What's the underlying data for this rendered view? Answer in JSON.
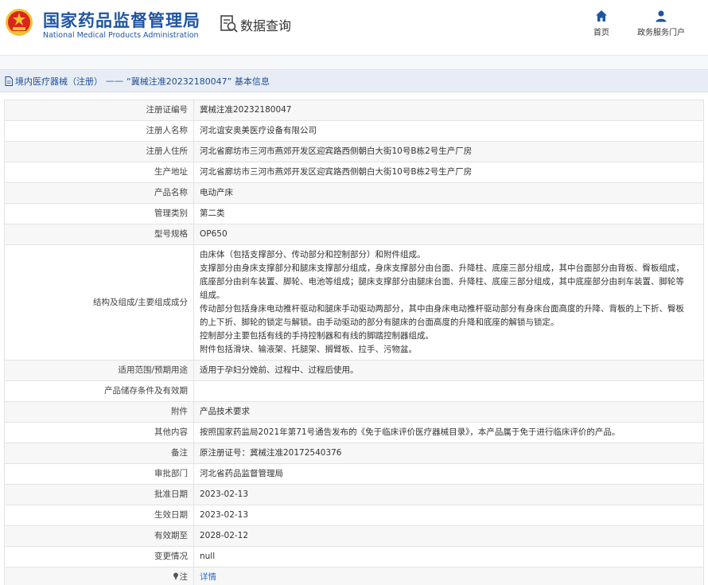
{
  "header": {
    "logo_cn": "国家药品监督管理局",
    "logo_en": "National Medical Products Administration",
    "query_title": "数据查询",
    "nav": [
      {
        "label": "首页",
        "icon": "home-icon"
      },
      {
        "label": "政务服务门户",
        "icon": "user-icon"
      }
    ]
  },
  "breadcrumb": {
    "category": "境内医疗器械（注册）",
    "separator": "——",
    "title": "“冀械注准20232180047” 基本信息"
  },
  "rows": [
    {
      "label": "注册证编号",
      "value": "冀械注准20232180047"
    },
    {
      "label": "注册人名称",
      "value": "河北谊安奥美医疗设备有限公司"
    },
    {
      "label": "注册人住所",
      "value": "河北省廊坊市三河市燕郊开发区迎宾路西侧朝白大街10号B栋2号生产厂房"
    },
    {
      "label": "生产地址",
      "value": "河北省廊坊市三河市燕郊开发区迎宾路西侧朝白大街10号B栋2号生产厂房"
    },
    {
      "label": "产品名称",
      "value": "电动产床"
    },
    {
      "label": "管理类别",
      "value": "第二类"
    },
    {
      "label": "型号规格",
      "value": "OP650"
    },
    {
      "label": "结构及组成/主要组成成分",
      "lines": [
        "由床体（包括支撑部分、传动部分和控制部分）和附件组成。",
        "支撑部分由身床支撑部分和腿床支撑部分组成，身床支撑部分由台面、升降柱、底座三部分组成，其中台面部分由背板、臀板组成，",
        "底座部分由刹车装置、脚轮、电池等组成；腿床支撑部分由腿床台面、升降柱、底座三部分组成，其中底座部分由刹车装置、脚轮等",
        "组成。",
        "传动部分包括身床电动推杆驱动和腿床手动驱动两部分，其中由身床电动推杆驱动部分有身床台面高度的升降、背板的上下折、臀板",
        "的上下折、脚轮的锁定与解锁。由手动驱动的部分有腿床的台面高度的升降和底座的解锁与锁定。",
        "控制部分主要包括有线的手持控制器和有线的脚踏控制器组成。",
        "附件包括滑块、输液架、托腿架、搁臂板、拉手、污物盆。"
      ]
    },
    {
      "label": "适用范围/预期用途",
      "value": "适用于孕妇分娩前、过程中、过程后使用。"
    },
    {
      "label": "产品储存条件及有效期",
      "value": ""
    },
    {
      "label": "附件",
      "value": "产品技术要求"
    },
    {
      "label": "其他内容",
      "value": "按照国家药监局2021年第71号通告发布的《免于临床评价医疗器械目录》，本产品属于免于进行临床评价的产品。"
    },
    {
      "label": "备注",
      "value": "原注册证号：冀械注准20172540376"
    },
    {
      "label": "审批部门",
      "value": "河北省药品监督管理局"
    },
    {
      "label": "批准日期",
      "value": "2023-02-13"
    },
    {
      "label": "生效日期",
      "value": "2023-02-13"
    },
    {
      "label": "有效期至",
      "value": "2028-02-12"
    },
    {
      "label": "变更情况",
      "value": "null"
    }
  ],
  "note_row": {
    "label": "注",
    "link": "详情"
  },
  "colors": {
    "brand_blue": "#1f55a3",
    "link_blue": "#2a6fc9",
    "breadcrumb_bg": "#e8edf5",
    "emblem_red": "#d9261c",
    "emblem_gold": "#f2c230"
  }
}
